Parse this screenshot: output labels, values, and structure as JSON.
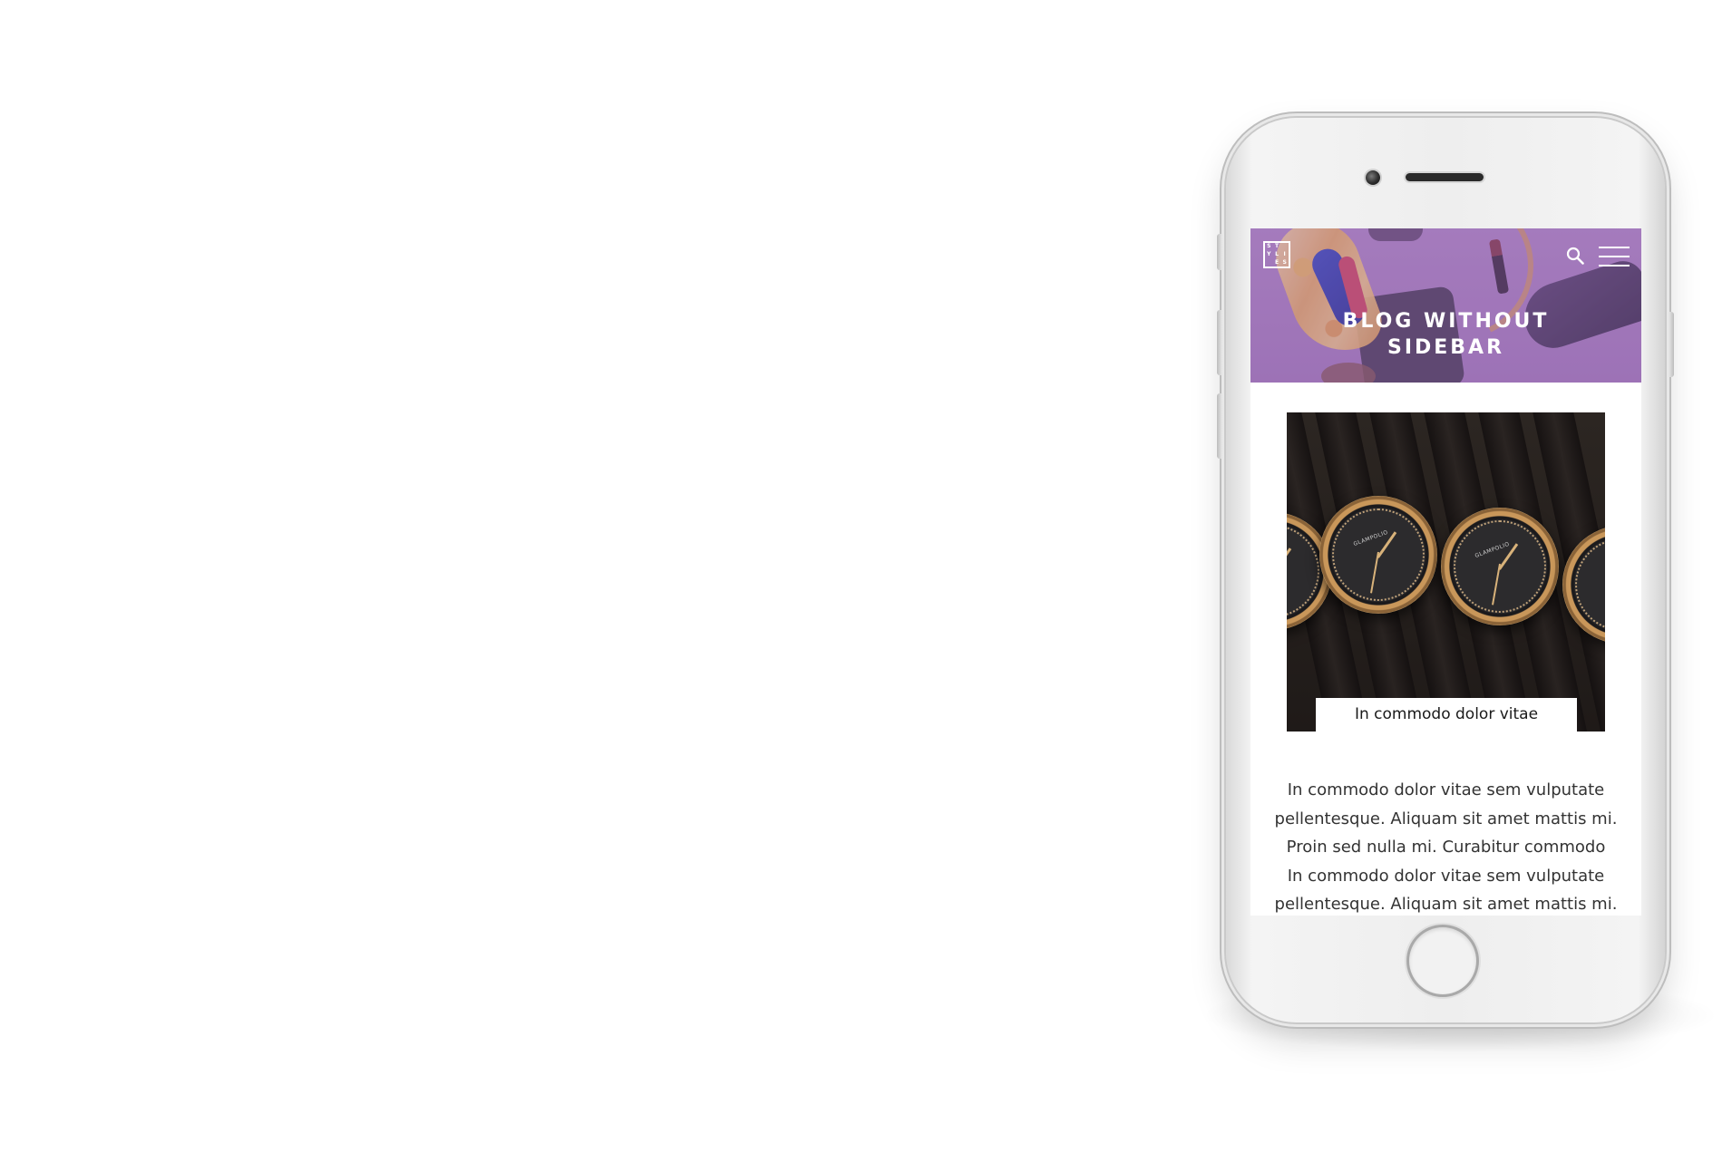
{
  "header": {
    "logo_letters": [
      "S",
      "T",
      "",
      "Y",
      "L",
      "I",
      "",
      "E",
      "S"
    ],
    "title_lines": [
      "BLOG WITHOUT",
      "SIDEBAR"
    ]
  },
  "post": {
    "image_brand": "GLAMPOLIO",
    "caption": "In commodo dolor vitae",
    "excerpt_lines": [
      "In commodo dolor vitae sem vulputate",
      "pellentesque. Aliquam sit amet mattis mi.",
      "Proin sed nulla mi. Curabitur commodo",
      "In commodo dolor vitae sem vulputate",
      "pellentesque. Aliquam sit amet mattis mi."
    ]
  },
  "icons": {
    "search": "search-icon",
    "menu": "hamburger-menu-icon"
  },
  "colors": {
    "hero_purple": "#9b6fb3",
    "text": "#333333",
    "caption_bg": "#ffffff"
  }
}
